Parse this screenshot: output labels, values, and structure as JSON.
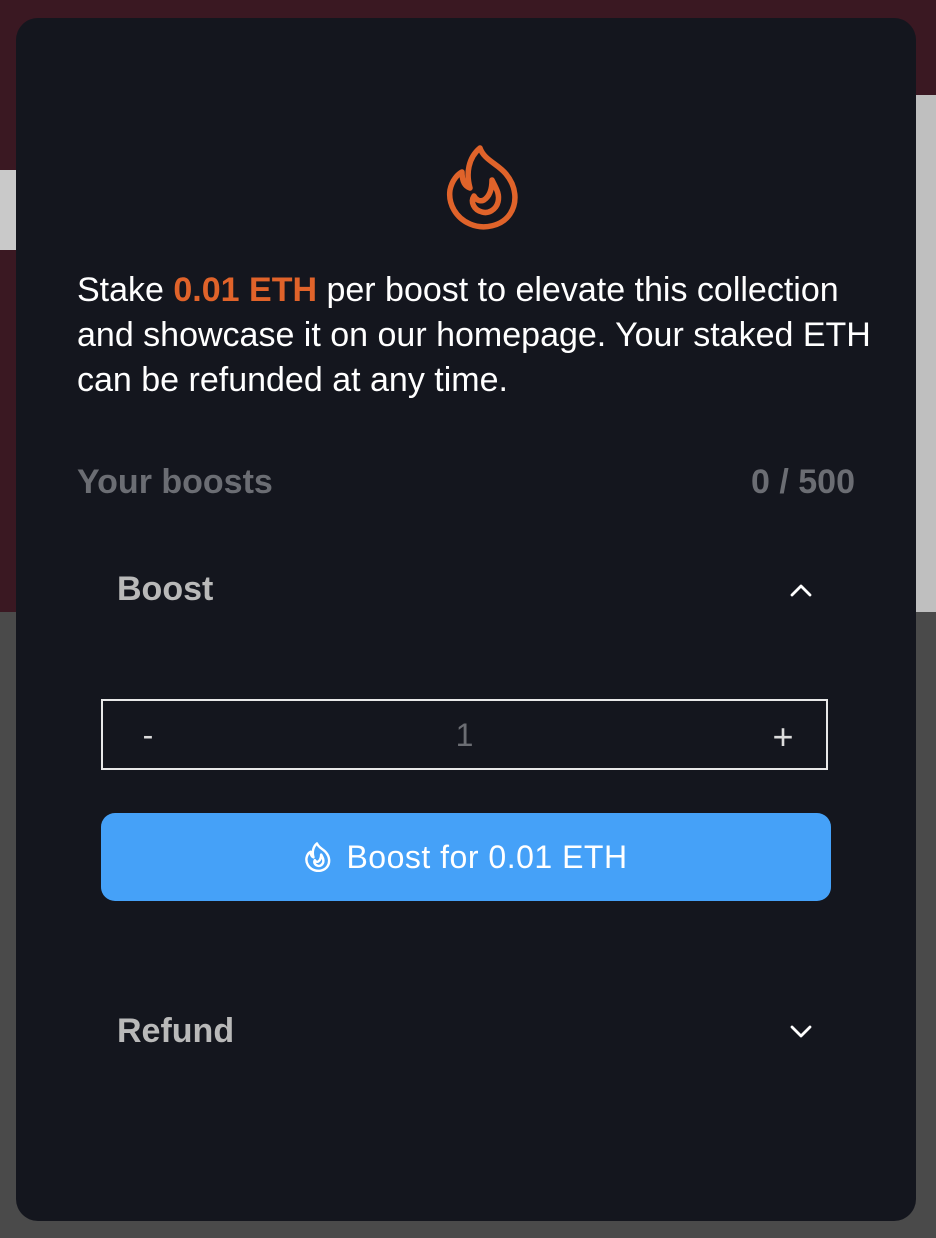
{
  "modal": {
    "description": {
      "prefix": "Stake ",
      "amount": "0.01 ETH",
      "suffix": " per boost to elevate this collection and showcase it on our homepage. Your staked ETH can be refunded at any time."
    },
    "boosts": {
      "label": "Your boosts",
      "count": "0 / 500"
    },
    "boost_section": {
      "title": "Boost",
      "expanded": true,
      "stepper": {
        "minus_label": "-",
        "value": "1",
        "plus_label": "+"
      },
      "button_label": "Boost for 0.01 ETH"
    },
    "refund_section": {
      "title": "Refund",
      "expanded": false
    }
  },
  "icons": {
    "header": "flame-icon",
    "button": "flame-icon",
    "boost_toggle": "chevron-up-icon",
    "refund_toggle": "chevron-down-icon"
  },
  "colors": {
    "accent": "#e0632a",
    "button": "#45a1f8",
    "modal_bg": "#14161e",
    "muted_text": "#6b6d73"
  }
}
